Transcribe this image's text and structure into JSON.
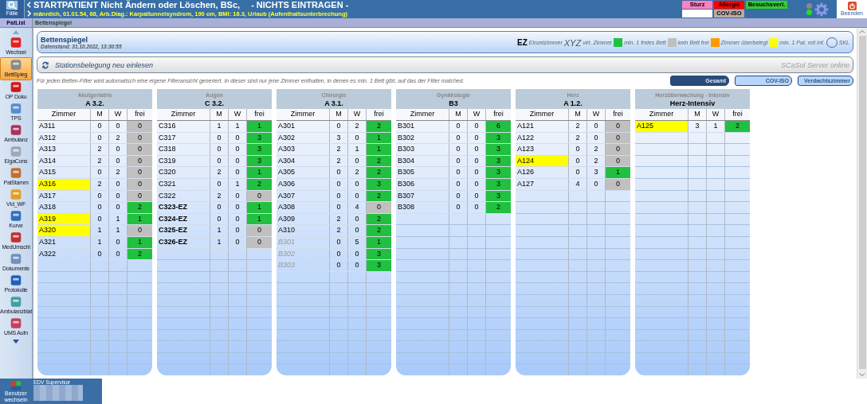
{
  "top_bar": {
    "cases_label": "Fälle",
    "title": "STARTPATIENT Nicht Ändern oder Löschen, BSc,",
    "warning": "- NICHTS  EINTRAGEN -",
    "subtitle": "männlich, 01.01.54, 68, Arb.Diag.: Karpaltunnelsyndrom, 190 cm, BMI:  16.3, Urlaub (Aufenthaltsunterbrechung)",
    "flags": [
      {
        "label": "Sturz",
        "color": "#ff80c0"
      },
      {
        "label": "Allergie",
        "color": "#ff0000"
      },
      {
        "label": "Besuchsverl.",
        "color": "#33cc33"
      },
      {
        "color": "#ffffff"
      },
      {
        "label": "COV-ISO",
        "color": "#b8aaa6"
      }
    ],
    "exit_label": "Beenden"
  },
  "tab_bar": {
    "left": "PatList",
    "title": "Bettenspiegel"
  },
  "sidebar": {
    "items": [
      {
        "label": "Wechsel",
        "selected": false
      },
      {
        "label": "BettSpieg",
        "selected": true
      },
      {
        "label": "OP Doku",
        "selected": false
      },
      {
        "label": "TPS",
        "selected": false
      },
      {
        "label": "Ambulanz",
        "selected": false
      },
      {
        "label": "ElgaCons",
        "selected": false
      },
      {
        "label": "PatStamm",
        "selected": false
      },
      {
        "label": "VId_WF",
        "selected": false
      },
      {
        "label": "Kurve",
        "selected": false
      },
      {
        "label": "MedUmschl",
        "selected": false
      },
      {
        "label": "Dokumente",
        "selected": false
      },
      {
        "label": "Protokolle",
        "selected": false
      },
      {
        "label": "Ambulanzblat",
        "selected": false
      },
      {
        "label": "UMS Aufn",
        "selected": false
      }
    ]
  },
  "header": {
    "title": "Bettenspiegel",
    "timestamp": "Datenstand: 31.10.2022, 13:30:55",
    "legend": [
      {
        "kind": "ez",
        "symbol": "EZ",
        "label": "Einzelzimmer"
      },
      {
        "kind": "virtual",
        "symbol": "XYZ",
        "label": "virt. Zimmer"
      },
      {
        "kind": "swatch",
        "color": "#22c040",
        "label": "min. 1 freies Bett"
      },
      {
        "kind": "swatch",
        "color": "#c0c0c0",
        "label": "kein Bett frei"
      },
      {
        "kind": "swatch",
        "color": "#ff9900",
        "label": "Zimmer überbelegt"
      },
      {
        "kind": "swatch",
        "color": "#ffff00",
        "label": "min. 1 Pat. mit Inf."
      },
      {
        "kind": "circle",
        "label": "SKL"
      }
    ]
  },
  "reload": {
    "label": "Stationsbelegung neu einlesen",
    "server_status": "SCaSol Server online"
  },
  "info": "Für jeden Betten-Filter wird automatisch eine eigene Filteransicht generiert. In dieser sind nur jene Zimmer enthalten, in denen es min. 1 Bett gibt, auf das der Filter matched.",
  "filters": [
    {
      "label": "Gesamt",
      "selected": true
    },
    {
      "label": "COV-ISO",
      "selected": false
    },
    {
      "label": "Verdachtszimmer",
      "selected": false
    }
  ],
  "wards": [
    {
      "department": "Akutgeriatrie",
      "code": "A 3.2.",
      "columns": [
        "Zimmer",
        "M",
        "W",
        "frei"
      ],
      "rooms": [
        {
          "room": "A311",
          "kind": "normal",
          "infected": false,
          "m": "0",
          "w": "0",
          "free": "0",
          "free_bed": false
        },
        {
          "room": "A312",
          "kind": "normal",
          "infected": false,
          "m": "0",
          "w": "2",
          "free": "0",
          "free_bed": false
        },
        {
          "room": "A313",
          "kind": "normal",
          "infected": false,
          "m": "2",
          "w": "0",
          "free": "0",
          "free_bed": false
        },
        {
          "room": "A314",
          "kind": "normal",
          "infected": false,
          "m": "2",
          "w": "0",
          "free": "0",
          "free_bed": false
        },
        {
          "room": "A315",
          "kind": "normal",
          "infected": false,
          "m": "0",
          "w": "2",
          "free": "0",
          "free_bed": false
        },
        {
          "room": "A316",
          "kind": "normal",
          "infected": true,
          "m": "2",
          "w": "0",
          "free": "0",
          "free_bed": false
        },
        {
          "room": "A317",
          "kind": "normal",
          "infected": false,
          "m": "0",
          "w": "0",
          "free": "0",
          "free_bed": false
        },
        {
          "room": "A318",
          "kind": "normal",
          "infected": false,
          "m": "0",
          "w": "0",
          "free": "2",
          "free_bed": true
        },
        {
          "room": "A319",
          "kind": "normal",
          "infected": true,
          "m": "0",
          "w": "1",
          "free": "1",
          "free_bed": true
        },
        {
          "room": "A320",
          "kind": "normal",
          "infected": true,
          "m": "1",
          "w": "1",
          "free": "0",
          "free_bed": false
        },
        {
          "room": "A321",
          "kind": "normal",
          "infected": false,
          "m": "1",
          "w": "0",
          "free": "1",
          "free_bed": true
        },
        {
          "room": "A322",
          "kind": "normal",
          "infected": false,
          "m": "0",
          "w": "0",
          "free": "2",
          "free_bed": true
        }
      ]
    },
    {
      "department": "Augen",
      "code": "C 3.2.",
      "columns": [
        "Zimmer",
        "M",
        "W",
        "frei"
      ],
      "rooms": [
        {
          "room": "C316",
          "kind": "normal",
          "infected": false,
          "m": "1",
          "w": "1",
          "free": "1",
          "free_bed": true
        },
        {
          "room": "C317",
          "kind": "normal",
          "infected": false,
          "m": "0",
          "w": "0",
          "free": "3",
          "free_bed": true
        },
        {
          "room": "C318",
          "kind": "normal",
          "infected": false,
          "m": "0",
          "w": "0",
          "free": "3",
          "free_bed": true
        },
        {
          "room": "C319",
          "kind": "normal",
          "infected": false,
          "m": "0",
          "w": "0",
          "free": "3",
          "free_bed": true
        },
        {
          "room": "C320",
          "kind": "normal",
          "infected": false,
          "m": "2",
          "w": "0",
          "free": "1",
          "free_bed": true
        },
        {
          "room": "C321",
          "kind": "normal",
          "infected": false,
          "m": "0",
          "w": "1",
          "free": "2",
          "free_bed": true
        },
        {
          "room": "C322",
          "kind": "normal",
          "infected": false,
          "m": "2",
          "w": "0",
          "free": "0",
          "free_bed": false
        },
        {
          "room": "C323-EZ",
          "kind": "ez",
          "infected": false,
          "m": "0",
          "w": "0",
          "free": "1",
          "free_bed": true
        },
        {
          "room": "C324-EZ",
          "kind": "ez",
          "infected": false,
          "m": "0",
          "w": "0",
          "free": "1",
          "free_bed": true
        },
        {
          "room": "C325-EZ",
          "kind": "ez",
          "infected": false,
          "m": "1",
          "w": "0",
          "free": "0",
          "free_bed": false
        },
        {
          "room": "C326-EZ",
          "kind": "ez",
          "infected": false,
          "m": "1",
          "w": "0",
          "free": "0",
          "free_bed": false
        }
      ]
    },
    {
      "department": "Chirurgie",
      "code": "A 3.1.",
      "columns": [
        "Zimmer",
        "M",
        "W",
        "frei"
      ],
      "rooms": [
        {
          "room": "A301",
          "kind": "normal",
          "infected": false,
          "m": "0",
          "w": "2",
          "free": "2",
          "free_bed": true
        },
        {
          "room": "A302",
          "kind": "normal",
          "infected": false,
          "m": "3",
          "w": "0",
          "free": "1",
          "free_bed": true
        },
        {
          "room": "A303",
          "kind": "normal",
          "infected": false,
          "m": "2",
          "w": "1",
          "free": "1",
          "free_bed": true
        },
        {
          "room": "A304",
          "kind": "normal",
          "infected": false,
          "m": "2",
          "w": "0",
          "free": "2",
          "free_bed": true
        },
        {
          "room": "A305",
          "kind": "normal",
          "infected": false,
          "m": "0",
          "w": "2",
          "free": "2",
          "free_bed": true
        },
        {
          "room": "A306",
          "kind": "normal",
          "infected": false,
          "m": "0",
          "w": "0",
          "free": "3",
          "free_bed": true
        },
        {
          "room": "A307",
          "kind": "normal",
          "infected": false,
          "m": "0",
          "w": "0",
          "free": "2",
          "free_bed": true
        },
        {
          "room": "A308",
          "kind": "normal",
          "infected": false,
          "m": "0",
          "w": "4",
          "free": "0",
          "free_bed": false
        },
        {
          "room": "A309",
          "kind": "normal",
          "infected": false,
          "m": "2",
          "w": "0",
          "free": "2",
          "free_bed": true
        },
        {
          "room": "A310",
          "kind": "normal",
          "infected": false,
          "m": "2",
          "w": "0",
          "free": "2",
          "free_bed": true
        },
        {
          "room": "B301",
          "kind": "virtual",
          "infected": false,
          "m": "0",
          "w": "5",
          "free": "1",
          "free_bed": true
        },
        {
          "room": "B302",
          "kind": "virtual",
          "infected": false,
          "m": "0",
          "w": "0",
          "free": "3",
          "free_bed": true
        },
        {
          "room": "B303",
          "kind": "virtual",
          "infected": false,
          "m": "0",
          "w": "0",
          "free": "3",
          "free_bed": true
        }
      ]
    },
    {
      "department": "Gynäkologie",
      "code": "B3",
      "columns": [
        "Zimmer",
        "M",
        "W",
        "frei"
      ],
      "rooms": [
        {
          "room": "B301",
          "kind": "normal",
          "infected": false,
          "m": "0",
          "w": "0",
          "free": "6",
          "free_bed": true
        },
        {
          "room": "B302",
          "kind": "normal",
          "infected": false,
          "m": "0",
          "w": "0",
          "free": "3",
          "free_bed": true
        },
        {
          "room": "B303",
          "kind": "normal",
          "infected": false,
          "m": "0",
          "w": "0",
          "free": "3",
          "free_bed": true
        },
        {
          "room": "B304",
          "kind": "normal",
          "infected": false,
          "m": "0",
          "w": "0",
          "free": "3",
          "free_bed": true
        },
        {
          "room": "B305",
          "kind": "normal",
          "infected": false,
          "m": "0",
          "w": "0",
          "free": "3",
          "free_bed": true
        },
        {
          "room": "B306",
          "kind": "normal",
          "infected": false,
          "m": "0",
          "w": "0",
          "free": "3",
          "free_bed": true
        },
        {
          "room": "B307",
          "kind": "normal",
          "infected": false,
          "m": "0",
          "w": "0",
          "free": "3",
          "free_bed": true
        },
        {
          "room": "B308",
          "kind": "normal",
          "infected": false,
          "m": "0",
          "w": "0",
          "free": "2",
          "free_bed": true
        }
      ]
    },
    {
      "department": "Herz",
      "code": "A 1.2.",
      "columns": [
        "Zimmer",
        "M",
        "W",
        "frei"
      ],
      "rooms": [
        {
          "room": "A121",
          "kind": "normal",
          "infected": false,
          "m": "2",
          "w": "0",
          "free": "0",
          "free_bed": false
        },
        {
          "room": "A122",
          "kind": "normal",
          "infected": false,
          "m": "2",
          "w": "0",
          "free": "0",
          "free_bed": false
        },
        {
          "room": "A123",
          "kind": "normal",
          "infected": false,
          "m": "0",
          "w": "2",
          "free": "0",
          "free_bed": false
        },
        {
          "room": "A124",
          "kind": "normal",
          "infected": true,
          "m": "0",
          "w": "2",
          "free": "0",
          "free_bed": false
        },
        {
          "room": "A126",
          "kind": "normal",
          "infected": false,
          "m": "0",
          "w": "3",
          "free": "1",
          "free_bed": true
        },
        {
          "room": "A127",
          "kind": "normal",
          "infected": false,
          "m": "4",
          "w": "0",
          "free": "0",
          "free_bed": false
        }
      ]
    },
    {
      "department": "Herzüberwachung - Intensiv",
      "code": "Herz-Intensiv",
      "columns": [
        "Zimmer",
        "M",
        "W",
        "frei"
      ],
      "rooms": [
        {
          "room": "A125",
          "kind": "normal",
          "infected": true,
          "m": "3",
          "w": "1",
          "free": "2",
          "free_bed": true
        }
      ]
    }
  ],
  "user_panel": {
    "switch_label": "Benutzer wechseln",
    "role": "EDV Supervisor"
  }
}
